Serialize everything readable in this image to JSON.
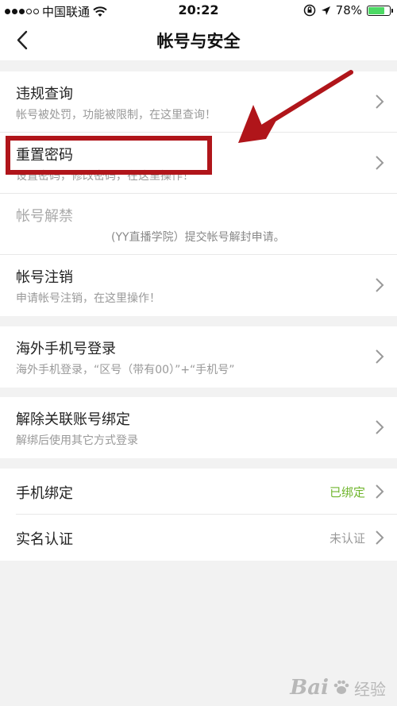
{
  "status_bar": {
    "carrier": "中国联通",
    "time": "20:22",
    "battery": "78%",
    "battery_level": 0.78
  },
  "nav": {
    "title": "帐号与安全"
  },
  "section1": [
    {
      "title": "违规查询",
      "subtitle": "帐号被处罚，功能被限制，在这里查询！"
    },
    {
      "title": "重置密码",
      "subtitle": "设置密码，修改密码，在这里操作！"
    },
    {
      "title": "帐号解禁",
      "subtitle": "(YY直播学院）提交帐号解封申请。"
    },
    {
      "title": "帐号注销",
      "subtitle": "申请帐号注销，在这里操作！"
    }
  ],
  "section2": {
    "title": "海外手机号登录",
    "subtitle": "海外手机登录，“区号（带有00）”+“手机号”"
  },
  "section3": {
    "title": "解除关联账号绑定",
    "subtitle": "解绑后使用其它方式登录"
  },
  "section4": [
    {
      "title": "手机绑定",
      "value": "已绑定"
    },
    {
      "title": "实名认证",
      "value": "未认证"
    }
  ],
  "colors": {
    "bound_green": "#6fb52c",
    "highlight_red": "#b0151a"
  },
  "watermark": {
    "logo": "Bai",
    "text": "经验"
  }
}
